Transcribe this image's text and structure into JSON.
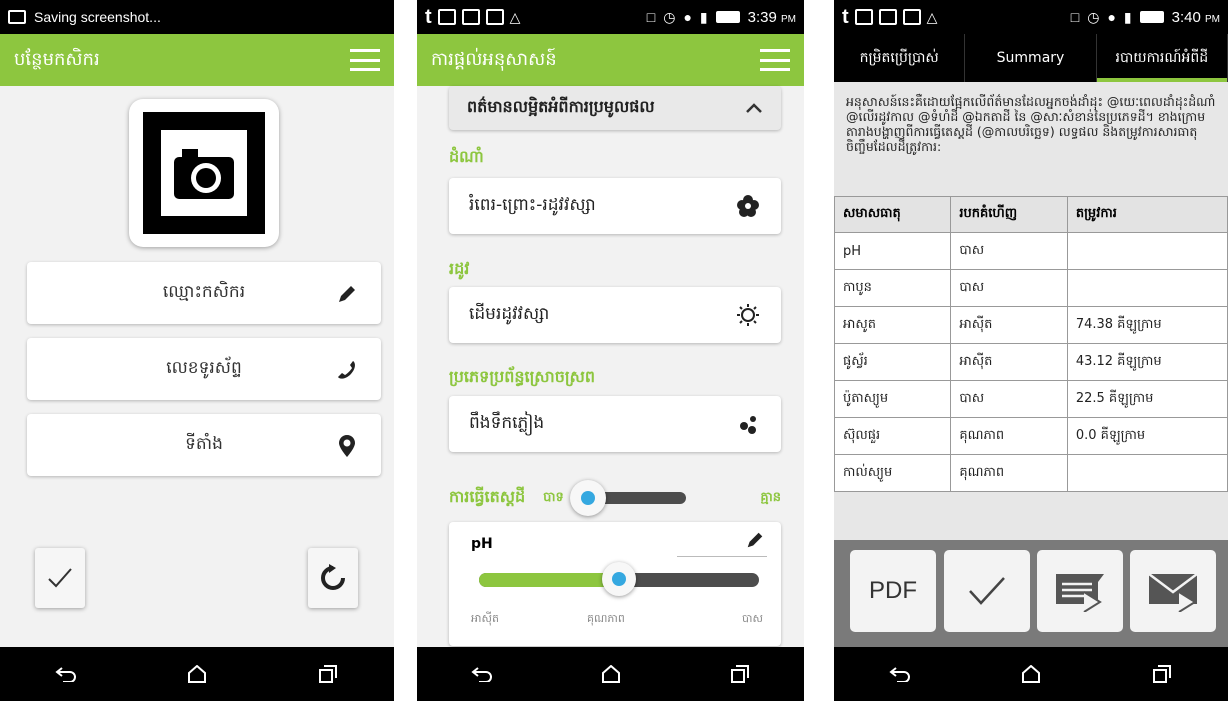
{
  "figure_label": "a",
  "screen1": {
    "status_text": "Saving screenshot...",
    "title": "បន្ថែមកសិករ",
    "fields": [
      {
        "label": "ឈ្មោះកសិករ",
        "icon": "pencil-icon"
      },
      {
        "label": "លេខទូរស័ព្ទ",
        "icon": "phone-icon"
      },
      {
        "label": "ទីតាំង",
        "icon": "location-pin-icon"
      }
    ],
    "buttons": {
      "confirm": "checkmark-icon",
      "reset": "refresh-icon"
    }
  },
  "screen2": {
    "time": "3:39",
    "ampm": "PM",
    "title": "ការផ្ដល់អនុសាសន៍",
    "section_header": "ពត៌មានលម្អិតអំពីការប្រមូលផល",
    "sections": [
      {
        "title": "ដំណាំ",
        "value": "រំពេរ-ព្រោះ-រដូវវស្សា",
        "icon": "flower-icon"
      },
      {
        "title": "រដូវ",
        "value": "ដើមរដូវវស្សា",
        "icon": "sun-icon"
      },
      {
        "title": "ប្រភេទប្រព័ន្ធស្រោចស្រព",
        "value": "ពឹងទឹកភ្លៀង",
        "icon": "water-drops-icon"
      }
    ],
    "soil_test": {
      "label": "ការធ្វើតេស្តដី",
      "yes": "បាទ",
      "no": "គ្មាន",
      "state": "yes"
    },
    "ph": {
      "label": "pH",
      "min_label": "អាស៊ីត",
      "mid_label": "គុណភាព",
      "max_label": "បាស",
      "level": 0.5
    }
  },
  "screen3": {
    "time": "3:40",
    "ampm": "PM",
    "tabs": [
      "កម្រិតប្រើប្រាស់",
      "Summary",
      "របាយការណ៍អំពីដី"
    ],
    "active_tab": 2,
    "description": "អនុសាសន៍នេះគឺដោយផ្អែកលើព័ត៌មានដែលអ្នកចង់ដាំដុះ @យេៈពេលដាំដុះដំណាំ @លើរដូវកាល @ទំហំដី @ឯកតាដី នៃ @សាៈសំខាន់នៃប្រភេទដី។ ខាងក្រោមតារាងបង្ហាញពីការធ្វើតេស្តដី (@កាលបរិច្ឆេទ) លទ្ធផល និងតម្រូវការសារធាតុចិញ្ចឹមដែលដីត្រូវការ:",
    "table": {
      "headers": [
        "សមាសធាតុ",
        "របកគំហើញ",
        "តម្រូវការ"
      ],
      "rows": [
        [
          "pH",
          "បាស",
          ""
        ],
        [
          "កាបូន",
          "បាស",
          ""
        ],
        [
          "អាសូត",
          "អាស៊ីត",
          "74.38 គីឡូក្រាម"
        ],
        [
          "ផូស្វ័រ",
          "អាស៊ីត",
          "43.12 គីឡូក្រាម"
        ],
        [
          "ប៉ូតាស្យូម",
          "បាស",
          "22.5 គីឡូក្រាម"
        ],
        [
          "ស៊ុលផួរ",
          "គុណភាព",
          "0.0 គីឡូក្រាម"
        ],
        [
          "កាល់ស្យូម",
          "គុណភាព",
          ""
        ]
      ]
    },
    "actions": {
      "pdf": "PDF"
    }
  },
  "colors": {
    "accent": "#8dc63f",
    "status_bar": "#000000",
    "action_bar": "#7a7a7a"
  }
}
